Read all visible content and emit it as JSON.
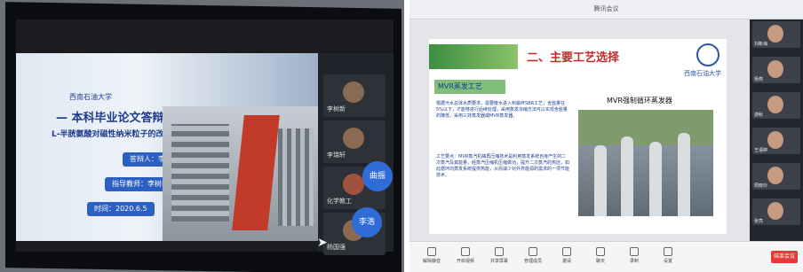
{
  "left_photo": {
    "slide": {
      "logo": "西南石油大学",
      "title": "— 本科毕业论文答辩",
      "subtitle": "L-半胱氨酸对磁性纳米粒子的改性研究",
      "pills": [
        "答辩人：李鑫",
        "指导教师：李树新",
        "时间：2020.6.5"
      ]
    },
    "participants": [
      "李树新",
      "李瑞轩",
      "化学教工",
      "杨国强"
    ],
    "bubbles": [
      "曲振",
      "李浩"
    ]
  },
  "right_photo": {
    "window_title": "腾讯会议",
    "slide": {
      "title": "二、主要工艺选择",
      "logo_text": "西南石油大学",
      "section": "MVR蒸发工艺",
      "image_label": "MVR强制循环蒸发器",
      "para1": "根据污水总体水质要求，需要废水进入到最终SBR工艺，含盐量在5%以下，才能够进行后续处理，采用蒸发浓缩方法可以实现含盐量的降低，采用三效蒸发器或MVR蒸发器。",
      "para2": "工艺要点：MVR蒸汽机械再压缩技术是利用蒸发系统自身产生的二次蒸汽及其能量，经蒸汽压缩机压缩做功，提升二次蒸汽的热焓，如此循环向蒸发系统提供热能，从而减少对外界能源的需求的一项节能技术。"
    },
    "participants": [
      "刘新海",
      "杨燕",
      "游秋",
      "王语婷",
      "周晓玲",
      "张亮"
    ],
    "toolbar": [
      "解除静音",
      "开启视频",
      "共享屏幕",
      "管理成员",
      "邀请",
      "聊天",
      "录制",
      "设置"
    ],
    "end_button": "结束会议"
  }
}
